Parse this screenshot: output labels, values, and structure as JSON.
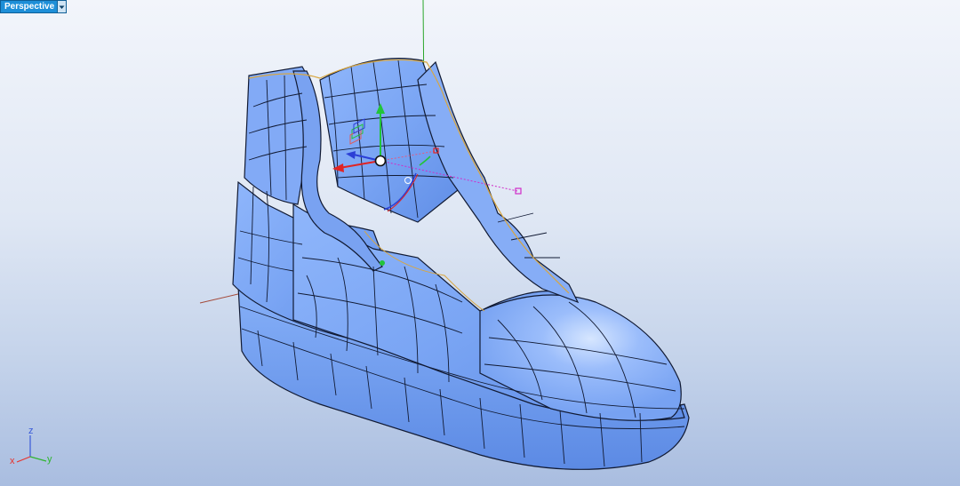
{
  "viewport": {
    "name": "Perspective",
    "menu_icon": "chevron-down-icon"
  },
  "world_axes": {
    "x_label": "x",
    "y_label": "y",
    "z_label": "z",
    "colors": {
      "x": "#e8322b",
      "y": "#2fb52f",
      "z": "#3a5ad8"
    }
  },
  "gizmo": {
    "icon": "gumball-move-rotate-icon",
    "colors": {
      "x": "#e02424",
      "y": "#22c43a",
      "z": "#2b3fd6",
      "handle": "#d02cc8"
    }
  },
  "model": {
    "surface_color": "#7fa9f4",
    "edge_color": "#111a33",
    "selected_edge_color": "#d8a640"
  }
}
